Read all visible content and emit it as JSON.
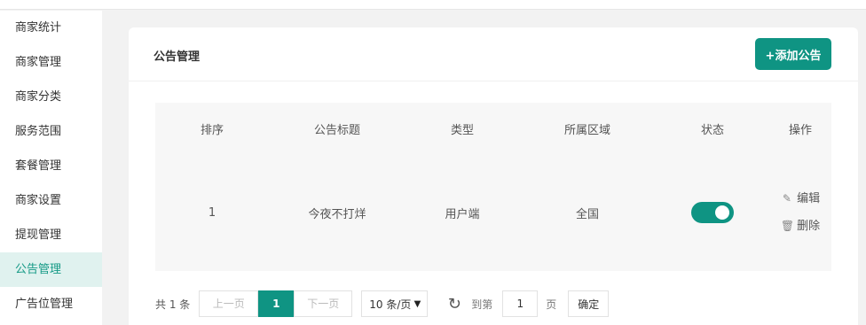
{
  "sidebar": {
    "items": [
      {
        "label": "商家统计"
      },
      {
        "label": "商家管理"
      },
      {
        "label": "商家分类"
      },
      {
        "label": "服务范围"
      },
      {
        "label": "套餐管理"
      },
      {
        "label": "商家设置"
      },
      {
        "label": "提现管理"
      },
      {
        "label": "公告管理",
        "active": true
      },
      {
        "label": "广告位管理"
      }
    ]
  },
  "panel": {
    "title": "公告管理",
    "add_button": "+添加公告"
  },
  "table": {
    "columns": [
      "排序",
      "公告标题",
      "类型",
      "所属区域",
      "状态",
      "操作"
    ],
    "rows": [
      {
        "order": "1",
        "title": "今夜不打烊",
        "type": "用户端",
        "region": "全国",
        "status_on": true,
        "edit": "编辑",
        "delete": "删除"
      }
    ]
  },
  "pagination": {
    "total": "共 1 条",
    "prev": "上一页",
    "current": "1",
    "next": "下一页",
    "page_size": "10 条/页",
    "goto_label": "到第",
    "goto_value": "1",
    "page_label": "页",
    "confirm": "确定"
  },
  "colors": {
    "accent": "#0f9483",
    "active_bg": "#e0f2ef"
  },
  "icons": {
    "edit": "pencil-icon",
    "delete": "trash-icon",
    "refresh": "refresh-icon",
    "caret": "caret-down-icon"
  }
}
